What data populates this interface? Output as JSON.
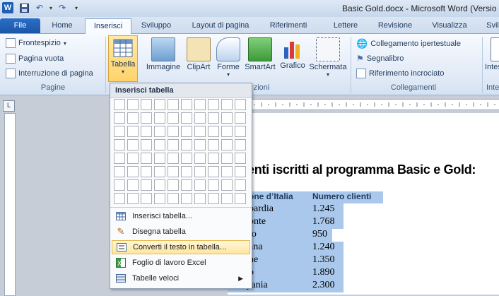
{
  "title": "Basic Gold.docx - Microsoft Word (Versio",
  "quick_access": [
    "save-icon",
    "undo-icon",
    "redo-icon",
    "customize-icon"
  ],
  "tabs": [
    "File",
    "Home",
    "Inserisci",
    "Sviluppo",
    "Layout di pagina",
    "Riferimenti",
    "Lettere",
    "Revisione",
    "Visualizza",
    "Svil"
  ],
  "active_tab": "Inserisci",
  "ribbon": {
    "pagine": {
      "items": [
        "Frontespizio",
        "Pagina vuota",
        "Interruzione di pagina"
      ],
      "label": "Pagine"
    },
    "tabella": {
      "label": "Tabella"
    },
    "illustrazioni": {
      "items": [
        "Immagine",
        "ClipArt",
        "Forme",
        "SmartArt",
        "Grafico",
        "Schermata"
      ],
      "label": "zioni"
    },
    "collegamenti": {
      "items": [
        "Collegamento ipertestuale",
        "Segnalibro",
        "Riferimento incrociato"
      ],
      "label": "Collegamenti"
    },
    "extra": {
      "item": "Intesta",
      "label": "Inte"
    }
  },
  "menu": {
    "title": "Inserisci tabella",
    "grid": {
      "cols": 10,
      "rows": 8
    },
    "items": [
      {
        "label": "Inserisci tabella...",
        "icon": "table-icon"
      },
      {
        "label": "Disegna tabella",
        "icon": "pencil-icon"
      },
      {
        "label": "Converti il testo in tabella...",
        "icon": "convert-icon",
        "highlighted": true
      },
      {
        "label": "Foglio di lavoro Excel",
        "icon": "excel-icon"
      },
      {
        "label": "Tabelle veloci",
        "icon": "quick-tables-icon",
        "submenu": true
      }
    ]
  },
  "document": {
    "heading": "enti iscritti al programma Basic e Gold:",
    "header_row": [
      "one d’Italia",
      "Numero clienti"
    ],
    "rows": [
      [
        "bardia",
        "1.245"
      ],
      [
        "onte",
        "1.768"
      ],
      [
        "to",
        "950"
      ],
      [
        "ana",
        "1.240"
      ],
      [
        "he",
        "1.350"
      ],
      [
        "o",
        "1.890"
      ],
      [
        "Campania",
        "2.300"
      ]
    ]
  },
  "colors": {
    "accent": "#1b56a8",
    "selection": "#a9c8ec",
    "highlight": "#ffe6a0"
  }
}
